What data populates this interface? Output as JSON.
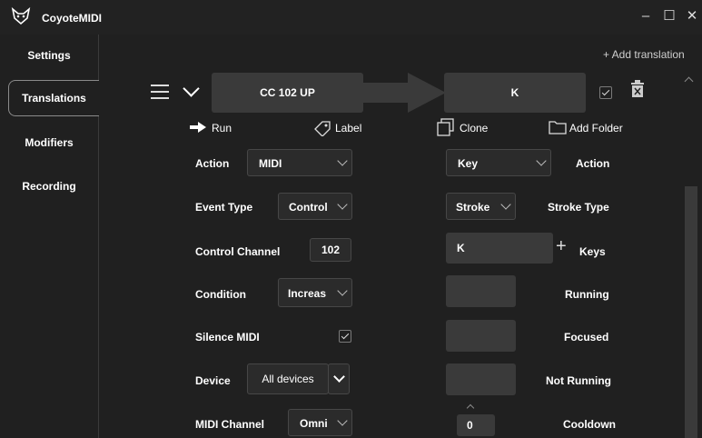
{
  "window": {
    "title": "CoyoteMIDI",
    "minimize": "–",
    "maximize": "☐",
    "close": "✕"
  },
  "sidebar": {
    "items": [
      {
        "label": "Settings"
      },
      {
        "label": "Translations",
        "active": true
      },
      {
        "label": "Modifiers"
      },
      {
        "label": "Recording"
      }
    ]
  },
  "main": {
    "add_translation": "+ Add translation",
    "translation": {
      "input_label": "CC 102 UP",
      "output_label": "K",
      "enabled": true
    },
    "actions": {
      "run": "Run",
      "label": "Label",
      "clone": "Clone",
      "add_folder": "Add Folder"
    },
    "midi": {
      "action_label": "Action",
      "action_value": "MIDI",
      "event_type_label": "Event Type",
      "event_type_value": "Control",
      "control_channel_label": "Control Channel",
      "control_channel_value": "102",
      "condition_label": "Condition",
      "condition_value": "Increas",
      "silence_midi_label": "Silence MIDI",
      "silence_midi_checked": true,
      "device_label": "Device",
      "device_value": "All devices",
      "midi_channel_label": "MIDI Channel",
      "midi_channel_value": "Omni"
    },
    "output": {
      "action_value": "Key",
      "action_label": "Action",
      "stroke_type_value": "Stroke",
      "stroke_type_label": "Stroke Type",
      "keys_value": "K",
      "keys_label": "Keys",
      "keys_add": "+",
      "running_label": "Running",
      "focused_label": "Focused",
      "not_running_label": "Not Running",
      "cooldown_value": "0",
      "cooldown_label": "Cooldown"
    }
  }
}
